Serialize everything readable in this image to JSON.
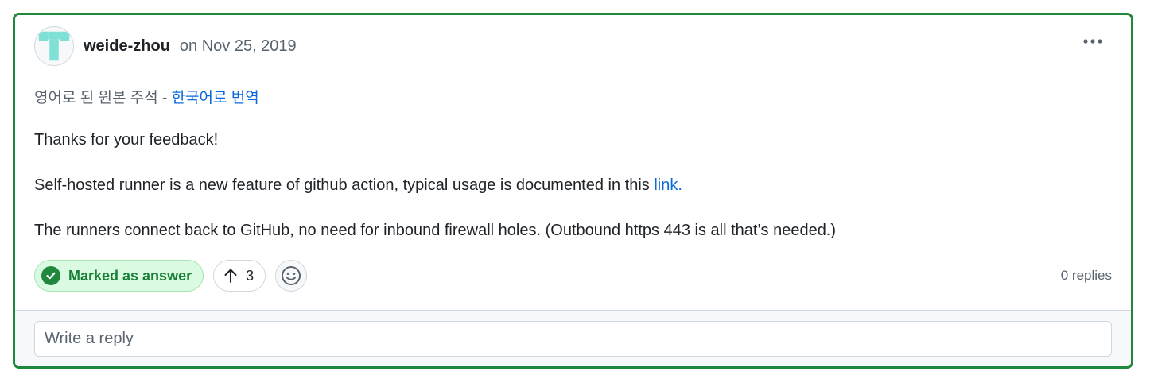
{
  "comment": {
    "author": "weide-zhou",
    "date": "on Nov 25, 2019",
    "translation_prefix": "영어로 된 원본 주석 - ",
    "translation_link": "한국어로 번역",
    "paragraph_1": "Thanks for your feedback!",
    "paragraph_2_text": "Self-hosted runner is a new feature of github action, typical usage is documented in this ",
    "paragraph_2_link": "link.",
    "paragraph_3": "The runners connect back to GitHub, no need for inbound firewall holes. (Outbound https 443 is all that’s needed.)"
  },
  "actions": {
    "answer_label": "Marked as answer",
    "upvote_count": "3",
    "replies": "0 replies"
  },
  "reply": {
    "placeholder": "Write a reply"
  },
  "icons": {
    "avatar": "identicon-avatar",
    "menu": "kebab-horizontal-icon",
    "answer": "check-circle-icon",
    "upvote": "arrow-up-icon",
    "emoji": "smiley-icon"
  },
  "colors": {
    "accent_green": "#1f883d",
    "link_blue": "#0969da",
    "answer_bg": "#dafbe1"
  }
}
